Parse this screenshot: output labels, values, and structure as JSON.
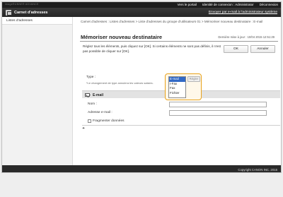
{
  "topbar": {
    "device_text": "imageRUNNER ADVANCE",
    "links": [
      "Vers le portail",
      "Identité de connexion : Administrator",
      "Déconnexion"
    ]
  },
  "header": {
    "app_title": "Carnet d'adresses",
    "app_icon": "address-book-icon",
    "email_admin_link": "Envoyer par e-mail à l'administrateur système"
  },
  "sidebar": {
    "items": [
      {
        "label": "Listes d'adresses"
      }
    ]
  },
  "main": {
    "breadcrumb": "Carnet d'adresses : Listes d'adresses > Liste d'adresses du groupe d'utilisateurs 01 > Mémoriser nouveau destinataire : E-mail",
    "page_title": "Mémoriser nouveau destinataire",
    "last_update": "Dernière mise à jour : 10/04 2015 12:51:29",
    "instructions": "Réglez tous les éléments, puis cliquez sur [OK]. Si certains éléments ne sont pas définis, il n'est pas possible de cliquer sur [OK].",
    "ok_label": "OK",
    "cancel_label": "Annuler",
    "type": {
      "label": "Type :",
      "note": "*Le changement de type annulera les valeurs saisies.",
      "options": [
        "E-mail",
        "I-Fax",
        "Fax",
        "Fichier"
      ],
      "selected_index": 0,
      "apply_label": "Régler"
    },
    "email_section": {
      "title": "E-mail",
      "icon": "mail-icon",
      "name_label": "Nom :",
      "name_value": "",
      "address_label": "Adresse e-mail :",
      "address_value": "",
      "fragment_label": "Fragmenter données",
      "fragment_checked": false
    },
    "top_icon": "back-to-top-icon"
  },
  "footer": {
    "copyright": "Copyright CANON INC. 2015"
  },
  "colors": {
    "topbar": "#1e1e1e",
    "header": "#2f2f2f",
    "highlight": "#e8a21b",
    "selected_option": "#3169c6",
    "footer": "#2a2a2a"
  }
}
